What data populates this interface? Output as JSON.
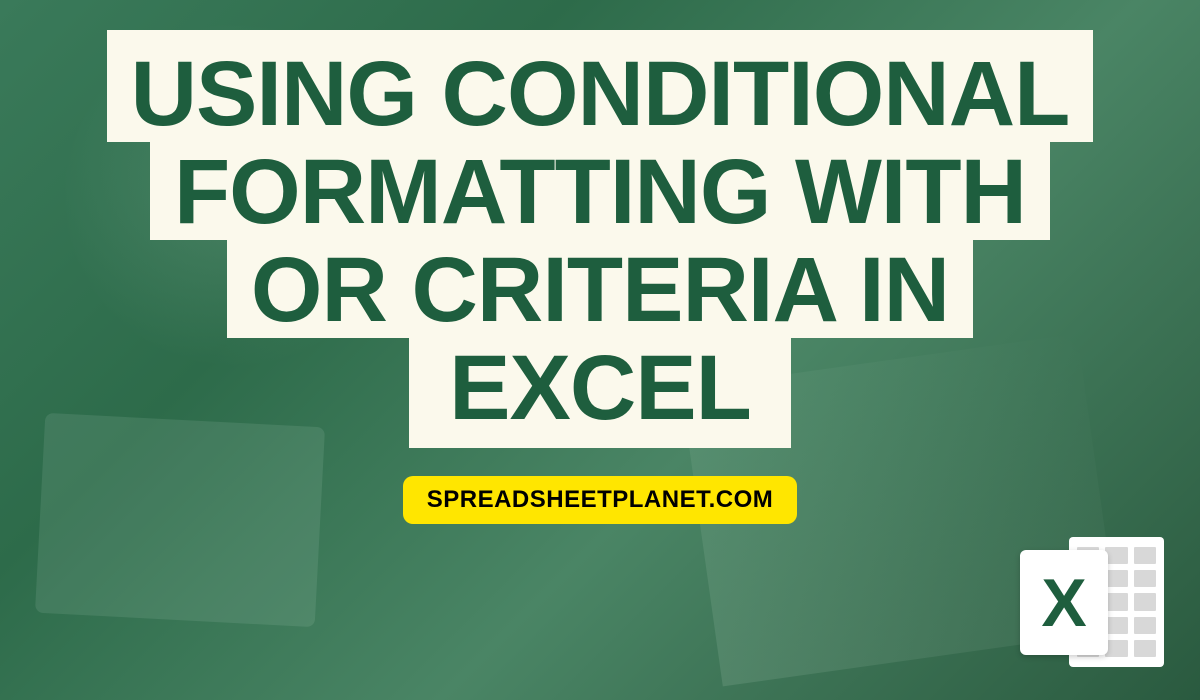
{
  "title": {
    "line1": "USING CONDITIONAL",
    "line2": "FORMATTING WITH",
    "line3": "OR CRITERIA IN",
    "line4": "EXCEL"
  },
  "domain_badge": "SPREADSHEETPLANET.COM",
  "icon": {
    "letter": "X",
    "name": "excel-icon"
  },
  "colors": {
    "title_text": "#1e5e3e",
    "title_bg": "#fbf9ec",
    "badge_bg": "#ffe600",
    "badge_text": "#000000",
    "page_bg": "#2d6b4a"
  }
}
